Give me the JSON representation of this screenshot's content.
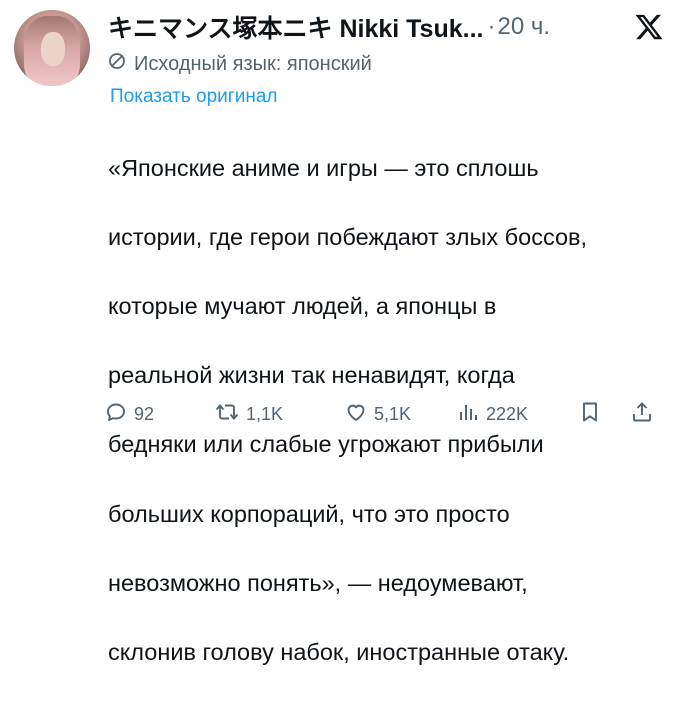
{
  "author": {
    "display_name": "キニマンス塚本ニキ Nikki Tsuk...",
    "time": "20 ч.",
    "separator": "·"
  },
  "translation": {
    "source_label": "Исходный язык: японский",
    "show_original": "Показать оригинал"
  },
  "tweet": {
    "text_lines": [
      "«Японские аниме и игры — это сплошь",
      "истории, где герои побеждают злых боссов,",
      "которые мучают людей, а японцы в",
      "реальной жизни так ненавидят, когда",
      "бедняки или слабые угрожают прибыли",
      "больших корпораций, что это просто",
      "невозможно понять», — недоумевают,",
      "склонив голову набок, иностранные отаку."
    ]
  },
  "actions": {
    "replies": "92",
    "reposts": "1,1K",
    "likes": "5,1K",
    "views": "222K"
  },
  "icons": {
    "x_logo": "x-logo-icon",
    "translate": "translate-icon",
    "reply": "reply-icon",
    "repost": "repost-icon",
    "like": "heart-icon",
    "views": "views-chart-icon",
    "bookmark": "bookmark-icon",
    "share": "share-icon"
  },
  "colors": {
    "text": "#0f1419",
    "secondary": "#536471",
    "link": "#1d9bf0"
  }
}
